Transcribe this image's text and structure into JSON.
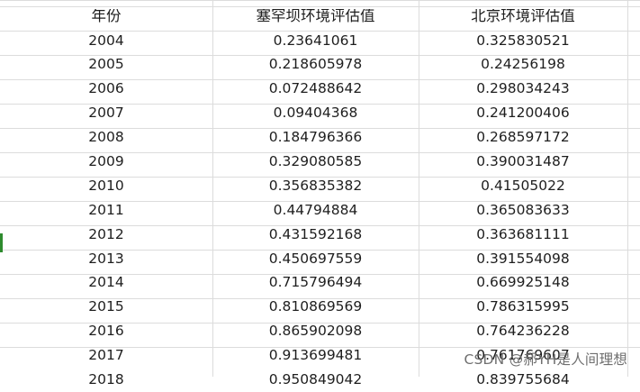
{
  "table": {
    "headers": [
      "年份",
      "塞罕坝环境评估值",
      "北京环境评估值"
    ],
    "rows": [
      [
        "2004",
        "0.23641061",
        "0.325830521"
      ],
      [
        "2005",
        "0.218605978",
        "0.24256198"
      ],
      [
        "2006",
        "0.072488642",
        "0.298034243"
      ],
      [
        "2007",
        "0.09404368",
        "0.241200406"
      ],
      [
        "2008",
        "0.184796366",
        "0.268597172"
      ],
      [
        "2009",
        "0.329080585",
        "0.390031487"
      ],
      [
        "2010",
        "0.356835382",
        "0.41505022"
      ],
      [
        "2011",
        "0.44794884",
        "0.365083633"
      ],
      [
        "2012",
        "0.431592168",
        "0.363681111"
      ],
      [
        "2013",
        "0.450697559",
        "0.391554098"
      ],
      [
        "2014",
        "0.715796494",
        "0.669925148"
      ],
      [
        "2015",
        "0.810869569",
        "0.786315995"
      ],
      [
        "2016",
        "0.865902098",
        "0.764236228"
      ],
      [
        "2017",
        "0.913699481",
        "0.761769607"
      ],
      [
        "2018",
        "0.950849042",
        "0.839755684"
      ]
    ]
  },
  "watermark": {
    "text": "CSDN @郝YH是人间理想"
  },
  "colors": {
    "gridline": "#dcdcdc",
    "text": "#1e1e1e",
    "row_marker": "#2e8b2e",
    "watermark": "#6f6f6f"
  }
}
